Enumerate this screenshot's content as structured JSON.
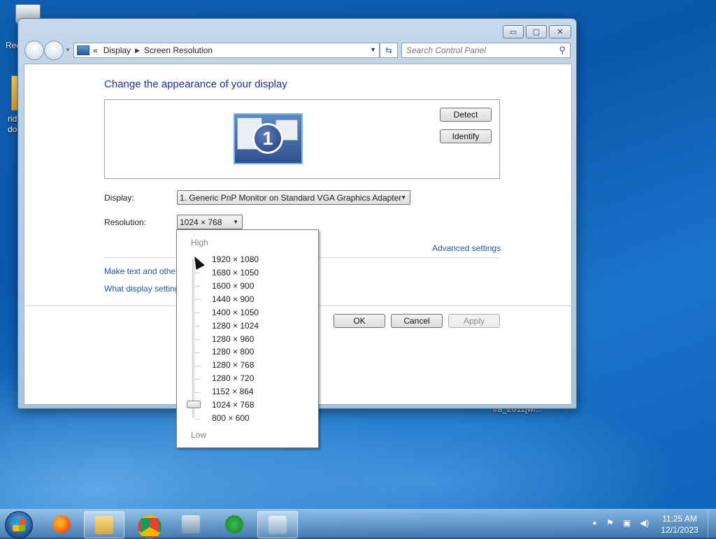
{
  "desktop": {
    "recycle_label": "Rec",
    "folder_label_1": "rid",
    "folder_label_2": "do",
    "truncated_label": "ira_2011[wi..."
  },
  "window": {
    "controls": {
      "minimize": "▭",
      "maximize": "▢",
      "close": "✕"
    },
    "breadcrumb": {
      "prefix": "«",
      "items": [
        "Display",
        "Screen Resolution"
      ]
    },
    "search": {
      "placeholder": "Search Control Panel"
    }
  },
  "main": {
    "heading": "Change the appearance of your display",
    "monitor_number": "1",
    "detect_label": "Detect",
    "identify_label": "Identify",
    "display_label": "Display:",
    "display_value": "1. Generic PnP Monitor on Standard VGA Graphics Adapter",
    "resolution_label": "Resolution:",
    "resolution_value": "1024 × 768",
    "advanced_link": "Advanced settings",
    "link_text_size": "Make text and other",
    "link_display_settings": "What display setting",
    "ok_label": "OK",
    "cancel_label": "Cancel",
    "apply_label": "Apply"
  },
  "resolution_popup": {
    "high_label": "High",
    "low_label": "Low",
    "options": [
      "1920 × 1080",
      "1680 × 1050",
      "1600 × 900",
      "1440 × 900",
      "1400 × 1050",
      "1280 × 1024",
      "1280 × 960",
      "1280 × 800",
      "1280 × 768",
      "1280 × 720",
      "1152 × 864",
      "1024 × 768",
      "800 × 600"
    ],
    "selected": "1024 × 768"
  },
  "taskbar": {
    "apps": [
      "start-button",
      "firefox",
      "file-explorer",
      "chrome",
      "network-tool",
      "ea-app",
      "control-panel"
    ],
    "tray_icons": [
      "show-hidden-icons",
      "action-center-icon",
      "network-icon",
      "volume-icon"
    ],
    "time": "11:25 AM",
    "date": "12/1/2023"
  },
  "colors": {
    "accent": "#1e3287",
    "link": "#1c59a3"
  }
}
